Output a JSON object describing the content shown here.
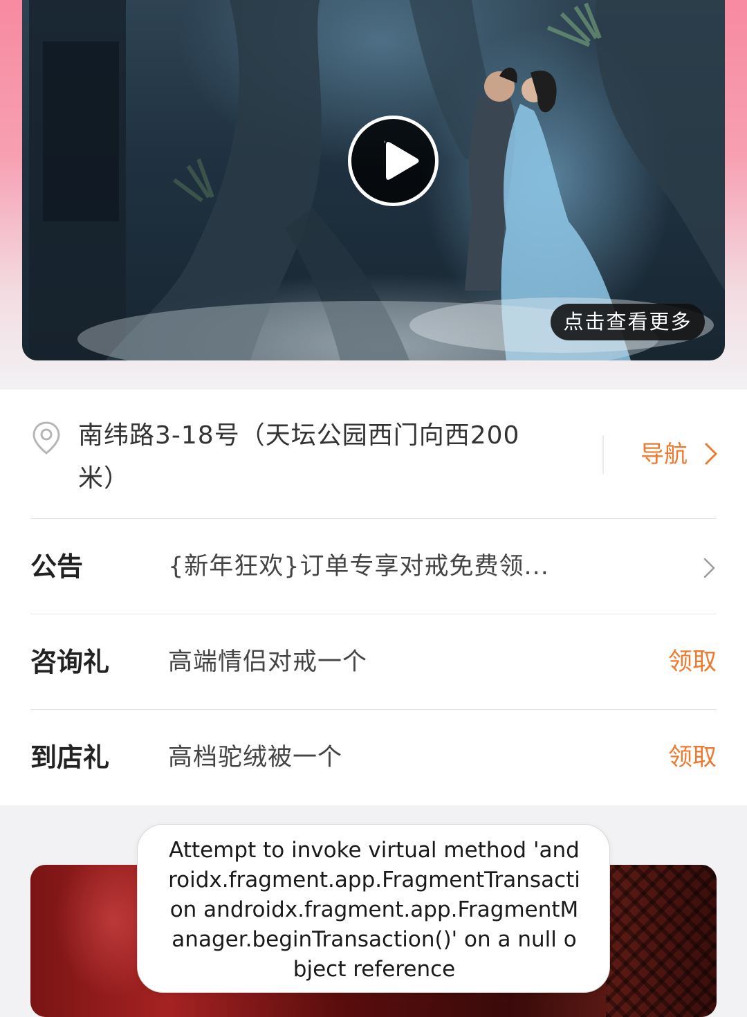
{
  "video": {
    "more_label": "点击查看更多",
    "play_icon": "play-icon"
  },
  "store": {
    "address": "南纬路3-18号（天坛公园西门向西200米）",
    "nav_label": "导航"
  },
  "rows": [
    {
      "label": "公告",
      "value": "{新年狂欢}订单专享对戒免费领...",
      "action": "chevron"
    },
    {
      "label": "咨询礼",
      "value": "高端情侣对戒一个",
      "action_label": "领取"
    },
    {
      "label": "到店礼",
      "value": "高档驼绒被一个",
      "action_label": "领取"
    }
  ],
  "toast": {
    "message": "Attempt to invoke virtual method 'androidx.fragment.app.FragmentTransaction androidx.fragment.app.FragmentManager.beginTransaction()' on a null object reference"
  },
  "colors": {
    "accent": "#ee7a2f",
    "top_gradient": "#f78aa0"
  }
}
